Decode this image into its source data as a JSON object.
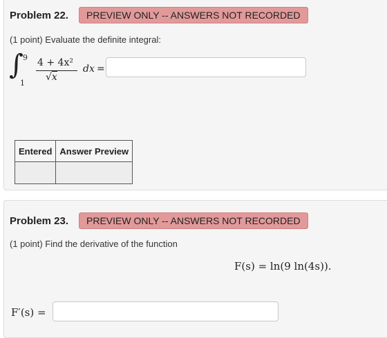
{
  "problem22": {
    "title": "Problem 22.",
    "badge": "PREVIEW ONLY -- ANSWERS NOT RECORDED",
    "points_text": "(1 point) Evaluate the definite integral:",
    "integral": {
      "upper": "9",
      "lower": "1",
      "numerator": "4 + 4x²",
      "denominator": "x",
      "differential": "dx",
      "equals": "="
    },
    "answer_value": "",
    "table": {
      "headers": [
        "Entered",
        "Answer Preview"
      ],
      "rows": [
        [
          "",
          ""
        ]
      ]
    }
  },
  "problem23": {
    "title": "Problem 23.",
    "badge": "PREVIEW ONLY -- ANSWERS NOT RECORDED",
    "points_text": "(1 point) Find the derivative of the function",
    "function_display": "F(s) = ln(9 ln(4s)).",
    "answer_label": "F′(s) =",
    "answer_value": ""
  }
}
